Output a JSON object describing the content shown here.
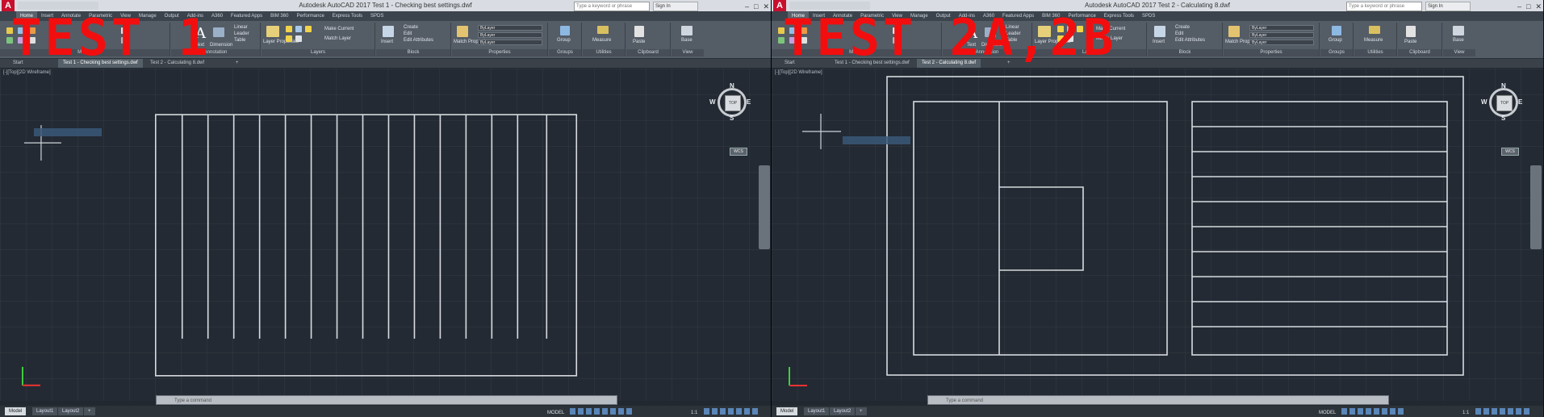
{
  "panes": [
    {
      "overlay_label": "TEST 1",
      "window_title": "Autodesk AutoCAD 2017   Test 1 - Checking best settings.dwf",
      "search_placeholder": "Type a keyword or phrase",
      "user_label": "Sign In",
      "ribbon_tabs": [
        "Home",
        "Insert",
        "Annotate",
        "Parametric",
        "View",
        "Manage",
        "Output",
        "Add-ins",
        "A360",
        "Featured Apps",
        "BIM 360",
        "Performance",
        "Express Tools",
        "SPDS"
      ],
      "ribbon": {
        "text_label": "Text",
        "dimension_label": "Dimension",
        "leader_label": "Leader",
        "table_label": "Table",
        "linear_label": "Linear",
        "layer_properties_label": "Layer Properties",
        "make_current_label": "Make Current",
        "match_layer_label": "Match Layer",
        "insert_label": "Insert",
        "create_label": "Create",
        "edit_label": "Edit",
        "edit_attributes_label": "Edit Attributes",
        "match_properties_label": "Match Properties",
        "bylayer": "ByLayer",
        "group_label": "Group",
        "measure_label": "Measure",
        "paste_label": "Paste",
        "base_label": "Base",
        "panel_labels": [
          "Modify",
          "Annotation",
          "Layers",
          "Block",
          "Properties",
          "Groups",
          "Utilities",
          "Clipboard",
          "View"
        ]
      },
      "doc_tabs": [
        "Start",
        "Test 1 - Checking best settings.dwf",
        "Test 2 - Calculating 8.dwf"
      ],
      "viewport_label": "[-][Top][2D Wireframe]",
      "navcube": {
        "top": "TOP",
        "n": "N",
        "s": "S",
        "e": "E",
        "w": "W",
        "wcs": "WCS"
      },
      "cmd_placeholder": "Type a command",
      "layout_tabs": [
        "Model",
        "Layout1",
        "Layout2"
      ],
      "model_label": "MODEL",
      "scale_label": "1:1"
    },
    {
      "overlay_label": "TEST 2A,2B",
      "window_title": "Autodesk AutoCAD 2017   Test 2 - Calculating 8.dwf",
      "search_placeholder": "Type a keyword or phrase",
      "user_label": "Sign In",
      "ribbon_tabs": [
        "Home",
        "Insert",
        "Annotate",
        "Parametric",
        "View",
        "Manage",
        "Output",
        "Add-ins",
        "A360",
        "Featured Apps",
        "BIM 360",
        "Performance",
        "Express Tools",
        "SPDS"
      ],
      "ribbon": {
        "text_label": "Text",
        "dimension_label": "Dimension",
        "leader_label": "Leader",
        "table_label": "Table",
        "linear_label": "Linear",
        "layer_properties_label": "Layer Properties",
        "make_current_label": "Make Current",
        "match_layer_label": "Match Layer",
        "insert_label": "Insert",
        "create_label": "Create",
        "edit_label": "Edit",
        "edit_attributes_label": "Edit Attributes",
        "match_properties_label": "Match Properties",
        "bylayer": "ByLayer",
        "group_label": "Group",
        "measure_label": "Measure",
        "paste_label": "Paste",
        "base_label": "Base",
        "panel_labels": [
          "Modify",
          "Annotation",
          "Layers",
          "Block",
          "Properties",
          "Groups",
          "Utilities",
          "Clipboard",
          "View"
        ]
      },
      "doc_tabs": [
        "Start",
        "Test 1 - Checking best settings.dwf",
        "Test 2 - Calculating 8.dwf"
      ],
      "viewport_label": "[-][Top][2D Wireframe]",
      "navcube": {
        "top": "TOP",
        "n": "N",
        "s": "S",
        "e": "E",
        "w": "W",
        "wcs": "WCS"
      },
      "cmd_placeholder": "Type a command",
      "layout_tabs": [
        "Model",
        "Layout1",
        "Layout2"
      ],
      "model_label": "MODEL",
      "scale_label": "1:1"
    }
  ],
  "colors": {
    "overlay_red": "#f20e0e",
    "viewport_bg": "#232a33",
    "line_color": "#d7dbe0",
    "ribbon_bg": "#545c66"
  }
}
